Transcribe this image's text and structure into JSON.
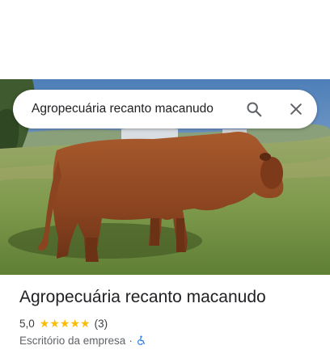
{
  "search": {
    "query": "Agropecuária recanto macanudo"
  },
  "place": {
    "name": "Agropecuária recanto macanudo",
    "rating_value": "5,0",
    "stars": 5,
    "review_count": "(3)",
    "category": "Escritório da empresa",
    "separator": "·"
  },
  "icons": {
    "search": "search-icon",
    "close": "close-icon",
    "accessibility": "wheelchair-accessible-icon",
    "star": "star-icon"
  },
  "colors": {
    "star": "#fbbc04",
    "accessibility": "#1a73e8",
    "title": "#202124",
    "secondary": "#5f6368"
  }
}
